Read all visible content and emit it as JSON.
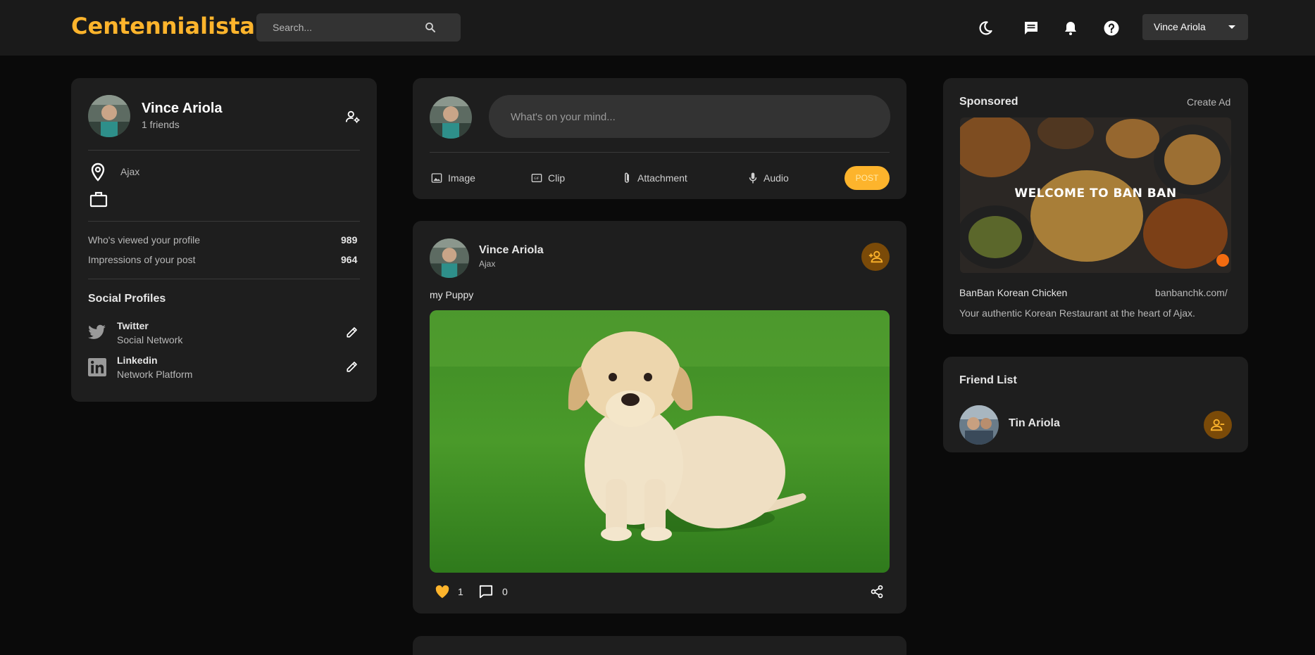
{
  "app": {
    "name": "Centennialista"
  },
  "search": {
    "placeholder": "Search..."
  },
  "nav": {
    "icons": [
      "moon-icon",
      "chat-icon",
      "bell-icon",
      "help-icon"
    ],
    "user_name": "Vince Ariola"
  },
  "profile": {
    "name": "Vince Ariola",
    "friends": "1 friends",
    "location": "Ajax",
    "occupation": "",
    "stats": [
      {
        "label": "Who's viewed your profile",
        "value": "989"
      },
      {
        "label": "Impressions of your post",
        "value": "964"
      }
    ],
    "social_title": "Social Profiles",
    "social": [
      {
        "name": "Twitter",
        "sub": "Social Network"
      },
      {
        "name": "Linkedin",
        "sub": "Network Platform"
      }
    ]
  },
  "composer": {
    "placeholder": "What's on your mind...",
    "tools": [
      "Image",
      "Clip",
      "Attachment",
      "Audio"
    ],
    "post_label": "POST"
  },
  "post": {
    "author": "Vince Ariola",
    "location": "Ajax",
    "text": "my Puppy",
    "likes": "1",
    "comments": "0"
  },
  "sponsored": {
    "title": "Sponsored",
    "create_ad": "Create Ad",
    "image_caption": "WELCOME TO BAN BAN",
    "name": "BanBan Korean Chicken",
    "url": "banbanchk.com/",
    "description": "Your authentic Korean Restaurant at the heart of Ajax."
  },
  "friend_list": {
    "title": "Friend List",
    "friends": [
      {
        "name": "Tin Ariola"
      }
    ]
  },
  "colors": {
    "accent": "#FDB42C",
    "background": "#0a0a0a",
    "card": "#1e1e1e",
    "navbar": "#1a1a1a",
    "button_dark": "#7a4a08"
  }
}
